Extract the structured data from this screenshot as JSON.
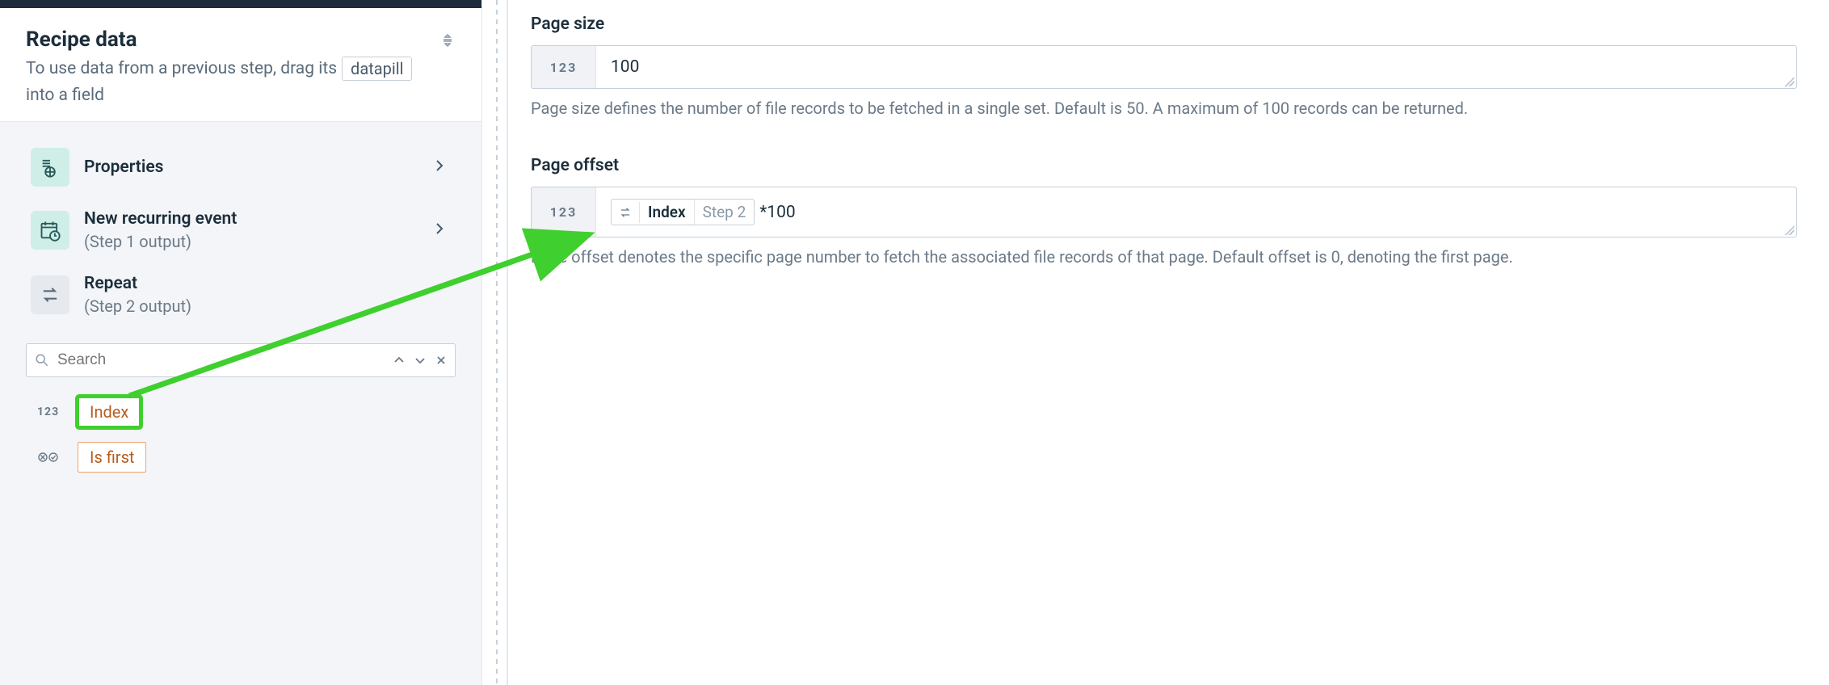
{
  "colors": {
    "accent_green": "#3fcf2e",
    "pill_border": "#f0a56a",
    "pill_text": "#b85c1e",
    "icon_teal": "#cfeee7"
  },
  "left": {
    "title": "Recipe data",
    "subtitle_prefix": "To use data from a previous step, drag its",
    "subtitle_token": "datapill",
    "subtitle_suffix": "into a field",
    "steps": [
      {
        "title": "Properties",
        "sub": ""
      },
      {
        "title": "New recurring event",
        "sub": "(Step 1 output)"
      },
      {
        "title": "Repeat",
        "sub": "(Step 2 output)"
      }
    ],
    "search_placeholder": "Search",
    "type_number_label": "123",
    "type_bool_label": "",
    "pills": [
      {
        "label": "Index"
      },
      {
        "label": "Is first"
      }
    ]
  },
  "right": {
    "fields": [
      {
        "label": "Page size",
        "type_indicator": "123",
        "value_text": "100",
        "help": "Page size defines the number of file records to be fetched in a single set. Default is 50. A maximum of 100 records can be returned."
      },
      {
        "label": "Page offset",
        "type_indicator": "123",
        "pill": {
          "name": "Index",
          "step": "Step 2"
        },
        "suffix": "*100",
        "help": "Page offset denotes the specific page number to fetch the associated file records of that page. Default offset is 0, denoting the first page."
      }
    ]
  }
}
